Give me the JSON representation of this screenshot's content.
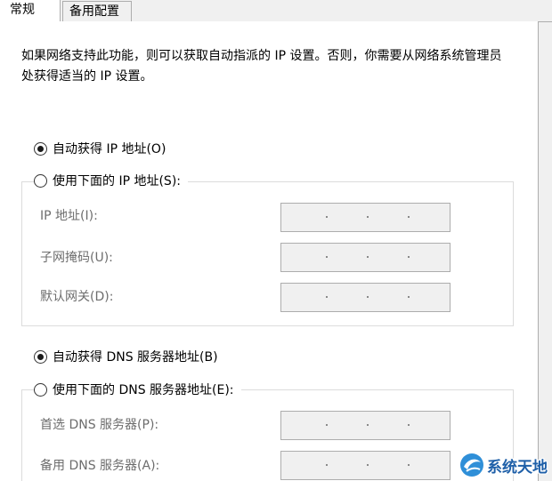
{
  "tabs": [
    {
      "label": "常规",
      "active": true
    },
    {
      "label": "备用配置",
      "active": false
    }
  ],
  "description": "如果网络支持此功能，则可以获取自动指派的 IP 设置。否则，你需要从网络系统管理员处获得适当的 IP 设置。",
  "ip": {
    "auto_label": "自动获得 IP 地址(O)",
    "auto_checked": true,
    "manual_label": "使用下面的 IP 地址(S):",
    "manual_checked": false,
    "fields": [
      {
        "label": "IP 地址(I):",
        "value": ". . ."
      },
      {
        "label": "子网掩码(U):",
        "value": ". . ."
      },
      {
        "label": "默认网关(D):",
        "value": ". . ."
      }
    ]
  },
  "dns": {
    "auto_label": "自动获得 DNS 服务器地址(B)",
    "auto_checked": true,
    "manual_label": "使用下面的 DNS 服务器地址(E):",
    "manual_checked": false,
    "fields": [
      {
        "label": "首选 DNS 服务器(P):",
        "value": ". . ."
      },
      {
        "label": "备用 DNS 服务器(A):",
        "value": ". . ."
      }
    ]
  },
  "watermark": {
    "text": "系统天地",
    "color": "#1e5fa8"
  },
  "colors": {
    "disabled_text": "#6d6d6d",
    "disabled_field_bg": "#f0f0f0",
    "border": "#adadad"
  }
}
